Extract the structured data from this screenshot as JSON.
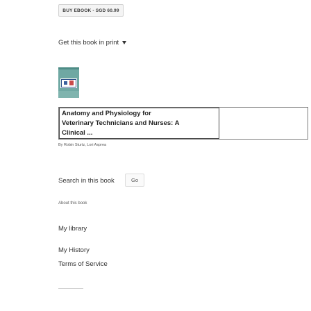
{
  "buy_button": {
    "label": "BUY EBOOK - SGD 60.99"
  },
  "print_link": {
    "label": "Get this book in print"
  },
  "cover": {
    "icon": "book-cover-image"
  },
  "book": {
    "title_lines": [
      "Anatomy and Physiology for",
      "Veterinary Technicians and Nurses: A",
      "Clinical ..."
    ],
    "authors": "By Robin Sturtz, Lori Asprea"
  },
  "search": {
    "label": "Search in this book",
    "go_label": "Go"
  },
  "links": {
    "about": "About this book",
    "my_library": "My library",
    "my_history": "My History",
    "terms": "Terms of Service"
  }
}
